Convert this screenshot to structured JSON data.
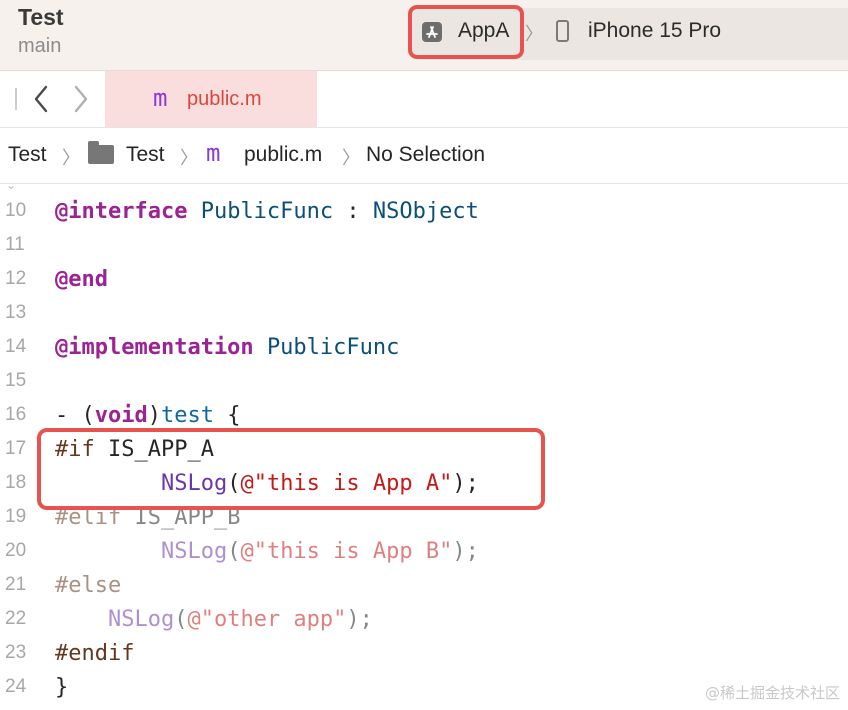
{
  "titlebar": {
    "project": "Test",
    "branch": "main",
    "scheme": "AppA",
    "device": "iPhone 15 Pro",
    "scheme_icon": "app-store-icon",
    "device_icon": "iphone-icon"
  },
  "tabbar": {
    "file_prefix": "m",
    "file_name": "public.m"
  },
  "breadcrumb": {
    "items": [
      "Test",
      "Test",
      "public.m",
      "No Selection"
    ],
    "separator": "〉",
    "file_prefix": "m"
  },
  "code": {
    "lines": [
      {
        "n": "10",
        "t": "@interface PublicFunc : NSObject"
      },
      {
        "n": "11",
        "t": ""
      },
      {
        "n": "12",
        "t": "@end"
      },
      {
        "n": "13",
        "t": ""
      },
      {
        "n": "14",
        "t": "@implementation PublicFunc"
      },
      {
        "n": "15",
        "t": ""
      },
      {
        "n": "16",
        "t": "- (void)test {"
      },
      {
        "n": "17",
        "t": "#if IS_APP_A"
      },
      {
        "n": "18",
        "t": "        NSLog(@\"this is App A\");"
      },
      {
        "n": "19",
        "t": "#elif IS_APP_B"
      },
      {
        "n": "20",
        "t": "        NSLog(@\"this is App B\");"
      },
      {
        "n": "21",
        "t": "#else"
      },
      {
        "n": "22",
        "t": "    NSLog(@\"other app\");"
      },
      {
        "n": "23",
        "t": "#endif"
      },
      {
        "n": "24",
        "t": "}"
      }
    ]
  },
  "watermark": "@稀土掘金技术社区",
  "colors": {
    "highlight_box": "#e8534f",
    "keyword": "#9b2393",
    "type": "#0b4f79",
    "string": "#c41a16",
    "preprocessor": "#643820",
    "tab_active": "#f9dedd"
  }
}
